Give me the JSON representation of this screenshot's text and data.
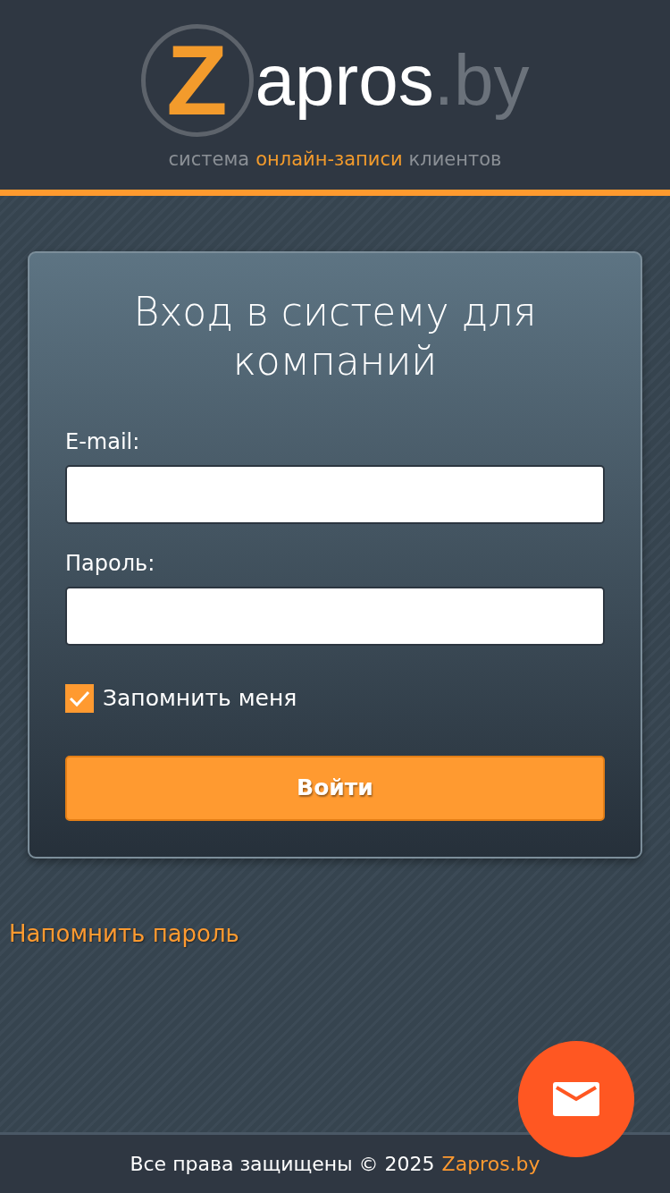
{
  "logo": {
    "letter": "Z",
    "name": "apros",
    "domain": ".by"
  },
  "tagline": [
    {
      "text": "система",
      "highlight": false
    },
    {
      "text": "онлайн-записи",
      "highlight": true
    },
    {
      "text": "клиентов",
      "highlight": false
    }
  ],
  "login": {
    "title": "Вход в систему для компаний",
    "fields": [
      {
        "label": "E-mail:"
      },
      {
        "label": "Пароль:"
      }
    ],
    "remember": {
      "label": "Запомнить меня",
      "checked": true
    },
    "submit": "Войти"
  },
  "forgot_link": "Напомнить пароль",
  "footer": {
    "text": "Все права защищены © 2025",
    "link": "Zapros.by"
  }
}
